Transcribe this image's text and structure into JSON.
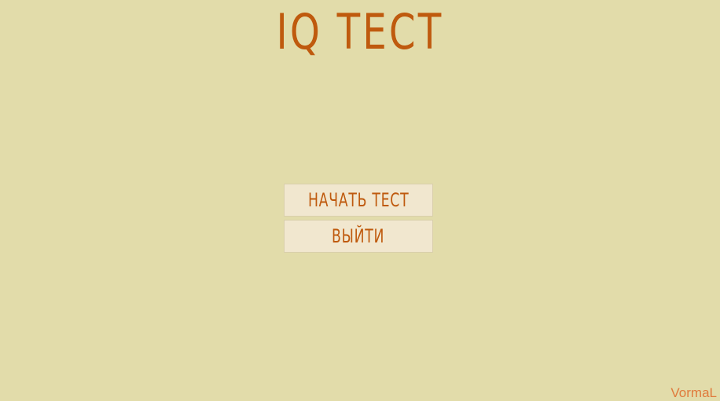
{
  "title": "IQ ТЕСТ",
  "menu": {
    "start_label": "НАЧАТЬ ТЕСТ",
    "exit_label": "ВЫЙТИ"
  },
  "watermark": "VormaL",
  "colors": {
    "background": "#e2dcaa",
    "accent_text": "#bf5a0e",
    "button_fill": "#f1e7cf",
    "watermark": "#e07a3c"
  }
}
